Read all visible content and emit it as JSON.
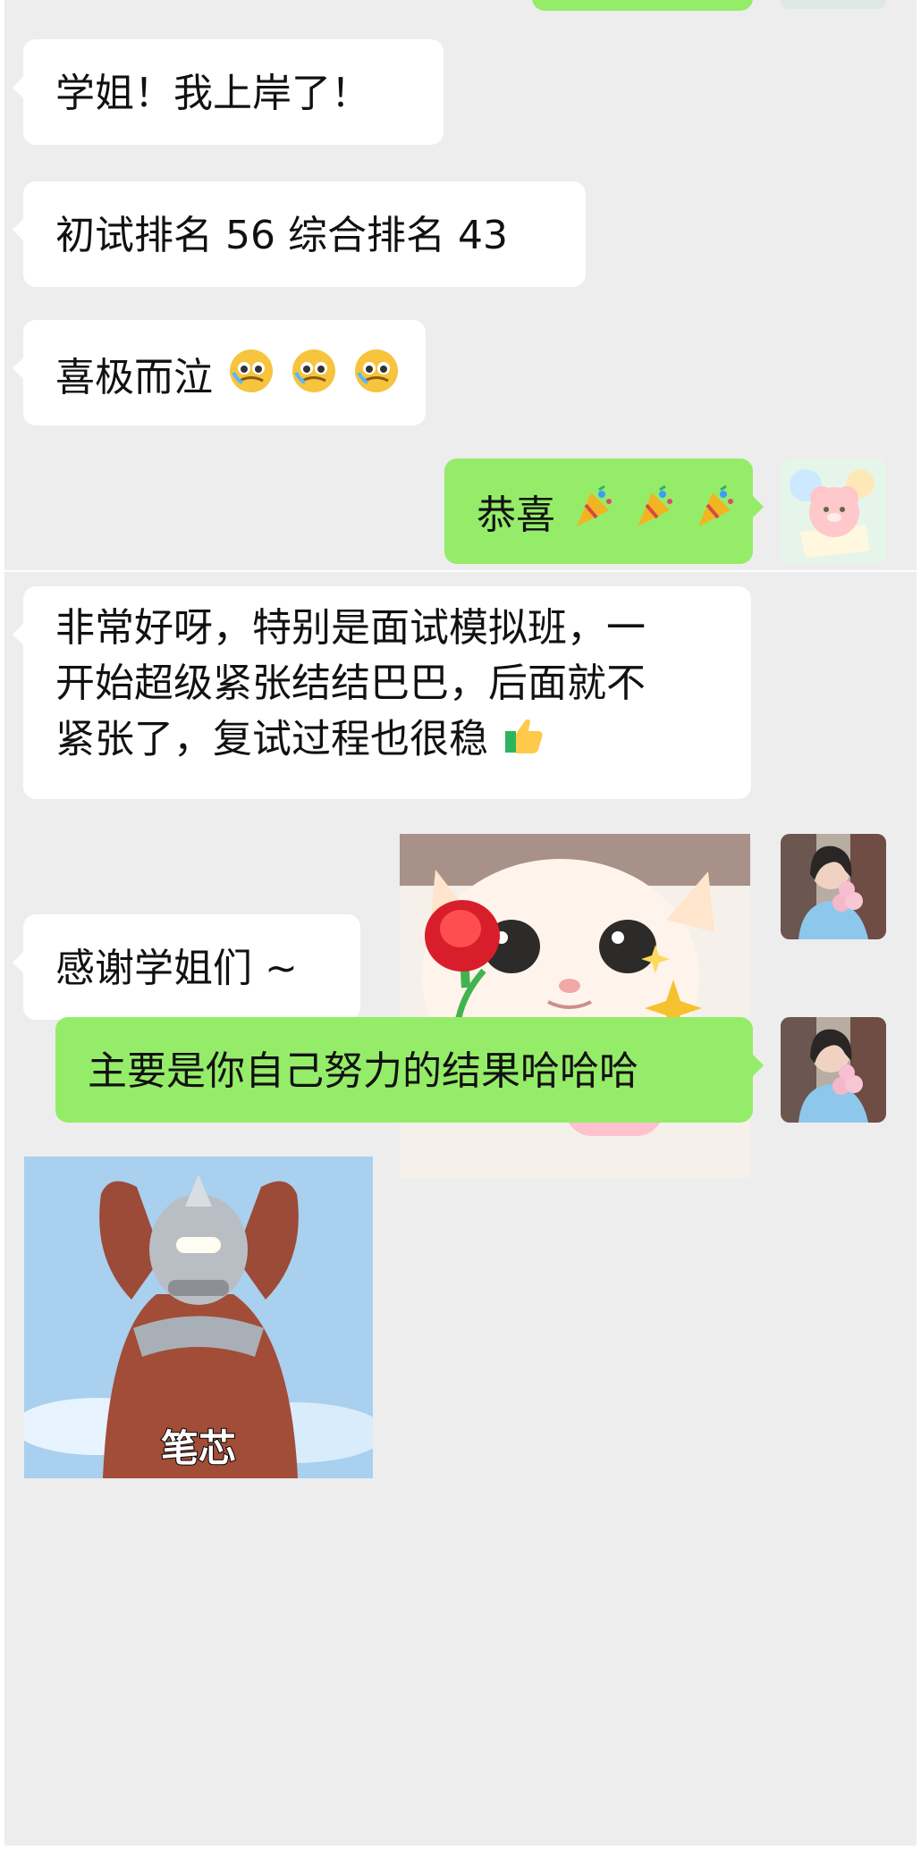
{
  "messages": {
    "m1": "学姐！我上岸了！",
    "m2": "初试排名 56 综合排名 43",
    "m3": "喜极而泣",
    "m4": "恭喜",
    "m5_line1": "非常好呀，特别是面试模拟班，一",
    "m5_line2": "开始超级紧张结结巴巴，后面就不",
    "m5_line3": "紧张了，复试过程也很稳",
    "m6": "感谢学姐们 ~",
    "m7": "主要是你自己努力的结果哈哈哈"
  },
  "stickers": {
    "sticker_cat": "cat-with-rose-sticker",
    "sticker_ultraman": "ultraman-sticker",
    "ultraman_caption": "笔芯"
  },
  "icons": {
    "m3": [
      "tearful-emoji",
      "tearful-emoji",
      "tearful-emoji"
    ],
    "m4": [
      "party-popper-emoji",
      "party-popper-emoji",
      "party-popper-emoji"
    ],
    "m5_end": "thumbs-up-emoji"
  },
  "colors": {
    "chat_background": "#ededed",
    "incoming_bubble": "#ffffff",
    "outgoing_bubble": "#95ec69",
    "text": "#111111"
  }
}
